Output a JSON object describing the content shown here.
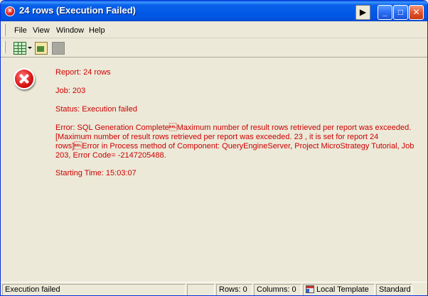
{
  "window": {
    "title": "24 rows (Execution Failed)",
    "controls": {
      "play": "▶",
      "minimize": "_",
      "maximize": "□",
      "close": "✕"
    }
  },
  "menu": {
    "items": [
      {
        "label": "File"
      },
      {
        "label": "View"
      },
      {
        "label": "Window"
      },
      {
        "label": "Help"
      }
    ]
  },
  "toolbar": {
    "icons": [
      "grid-view-icon",
      "dropdown-arrow-icon",
      "report-wizard-icon",
      "stop-icon"
    ]
  },
  "message": {
    "report": "Report: 24 rows",
    "job": "Job: 203",
    "status": "Status: Execution failed",
    "error": "Error: SQL Generation Complete\u0007Maximum number of result rows retrieved per report was exceeded.[Maximum number of result rows retrieved per report was exceeded. 23 , it is set for report 24 rows]\u0007Error in Process method of Component: QueryEngineServer, Project MicroStrategy Tutorial, Job 203, Error Code= -2147205488.",
    "starting_time": "Starting Time: 15:03:07"
  },
  "statusbar": {
    "status": "Execution failed",
    "rows": "Rows: 0",
    "columns": "Columns: 0",
    "template": "Local Template",
    "mode": "Standard"
  },
  "colors": {
    "error_text": "#cc0000",
    "titlebar": "#0058e6",
    "background": "#ece9d8"
  }
}
